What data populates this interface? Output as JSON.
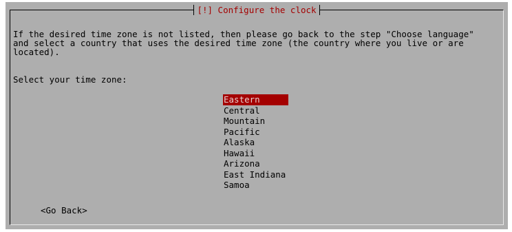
{
  "dialog": {
    "title": "[!] Configure the clock",
    "description": "If the desired time zone is not listed, then please go back to the step \"Choose language\"\nand select a country that uses the desired time zone (the country where you live or are\nlocated).",
    "prompt": "Select your time zone:"
  },
  "timezones": {
    "selected": "Eastern",
    "items": [
      {
        "label": "Eastern"
      },
      {
        "label": "Central"
      },
      {
        "label": "Mountain"
      },
      {
        "label": "Pacific"
      },
      {
        "label": "Alaska"
      },
      {
        "label": "Hawaii"
      },
      {
        "label": "Arizona"
      },
      {
        "label": "East Indiana"
      },
      {
        "label": "Samoa"
      }
    ]
  },
  "buttons": {
    "go_back": "<Go Back>"
  },
  "colors": {
    "background": "#aeaeae",
    "accent": "#a40000",
    "highlight_text": "#e7d2d2"
  }
}
